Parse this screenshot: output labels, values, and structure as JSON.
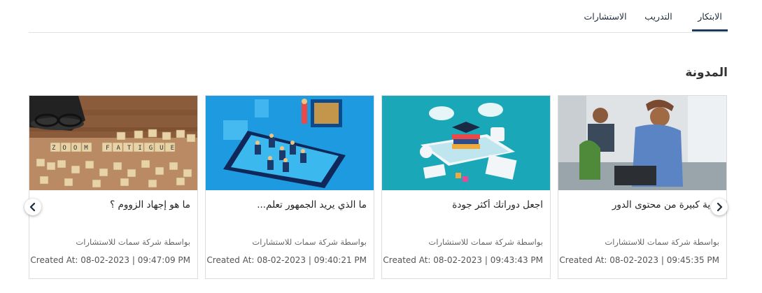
{
  "tabs": [
    {
      "label": "الابتكار",
      "active": true
    },
    {
      "label": "التدريب",
      "active": false
    },
    {
      "label": "الاستشارات",
      "active": false
    }
  ],
  "section": {
    "title": "المدونة"
  },
  "cards": [
    {
      "title": "ما هو إجهاد الزووم ؟",
      "author": "بواسطة شركة سمات للاستشارات",
      "date": "Created At: 08-02-2023 | 09:47:09 PM",
      "image": "zoom-fatigue-blocks-image",
      "image_text": "ZOOM FATIGUE"
    },
    {
      "title": "ما الذي يريد الجمهور تعلم...",
      "author": "بواسطة شركة سمات للاستشارات",
      "date": "Created At: 08-02-2023 | 09:40:21 PM",
      "image": "phone-audience-illustration"
    },
    {
      "title": "اجعل دوراتك أكثر جودة",
      "author": "بواسطة شركة سمات للاستشارات",
      "date": "Created At: 08-02-2023 | 09:43:43 PM",
      "image": "online-education-illustration"
    },
    {
      "title": "...ية كبيرة من محتوى الدور",
      "author": "بواسطة شركة سمات للاستشارات",
      "date": "Created At: 08-02-2023 | 09:45:35 PM",
      "image": "office-worker-photo"
    }
  ],
  "icons": {
    "prev": "chevron-left-icon",
    "next": "chevron-right-icon"
  },
  "colors": {
    "accent": "#1c3a5e",
    "teal": "#1aa8b8",
    "sky": "#1e9be0"
  }
}
